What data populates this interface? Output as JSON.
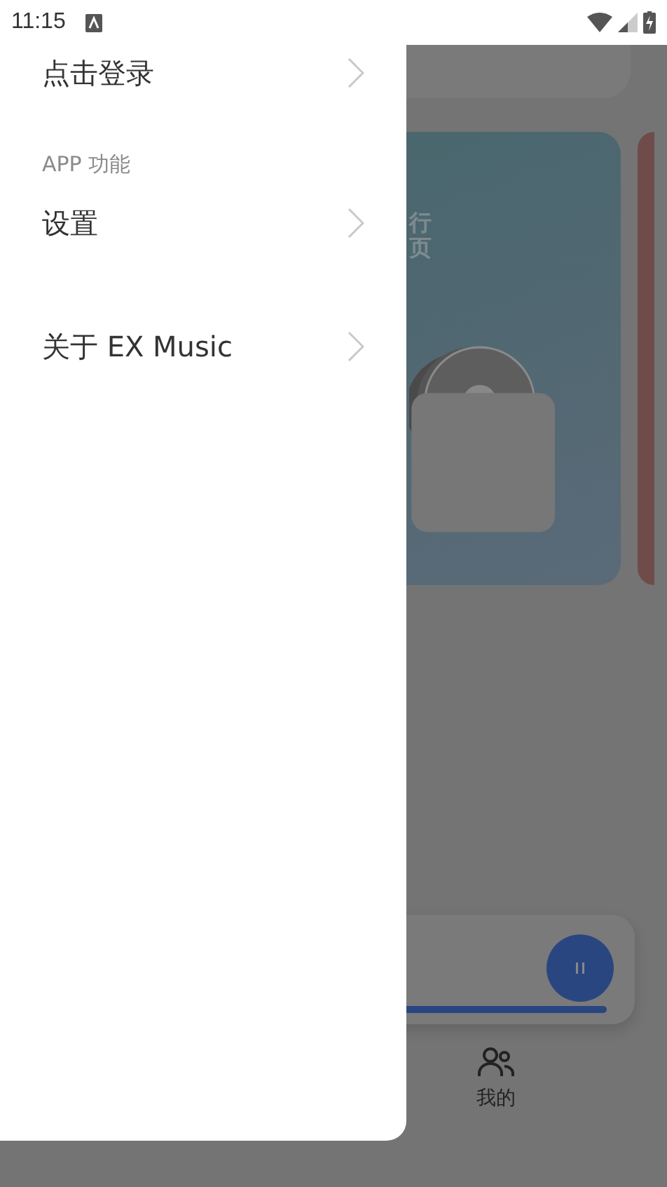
{
  "status_bar": {
    "time": "11:15"
  },
  "drawer": {
    "login": "点击登录",
    "section_title": "APP 功能",
    "items": [
      {
        "label": "设置"
      },
      {
        "label": "关于 EX Music"
      }
    ]
  },
  "background_app": {
    "banner": {
      "lines": [
        "行",
        "页"
      ]
    },
    "player": {
      "playing": true,
      "level": 0.98
    },
    "nav": [
      {
        "label": "我的"
      }
    ]
  }
}
